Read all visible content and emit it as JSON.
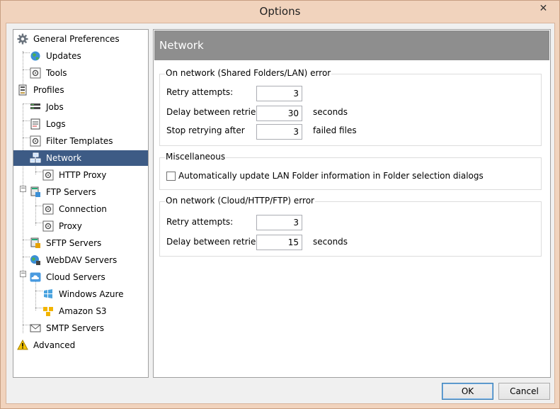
{
  "window": {
    "title": "Options",
    "close_glyph": "✕"
  },
  "tree": {
    "items": [
      {
        "label": "General Preferences",
        "icon": "gear-icon"
      },
      {
        "label": "Updates",
        "icon": "globe-icon"
      },
      {
        "label": "Tools",
        "icon": "tools-icon"
      },
      {
        "label": "Profiles",
        "icon": "profiles-icon"
      },
      {
        "label": "Jobs",
        "icon": "jobs-icon"
      },
      {
        "label": "Logs",
        "icon": "log-icon"
      },
      {
        "label": "Filter Templates",
        "icon": "filter-icon"
      },
      {
        "label": "Network",
        "icon": "network-icon"
      },
      {
        "label": "HTTP Proxy",
        "icon": "proxy-icon"
      },
      {
        "label": "FTP Servers",
        "icon": "ftp-icon"
      },
      {
        "label": "Connection",
        "icon": "connection-icon"
      },
      {
        "label": "Proxy",
        "icon": "proxy-icon"
      },
      {
        "label": "SFTP Servers",
        "icon": "sftp-icon"
      },
      {
        "label": "WebDAV Servers",
        "icon": "webdav-icon"
      },
      {
        "label": "Cloud Servers",
        "icon": "cloud-icon"
      },
      {
        "label": "Windows Azure",
        "icon": "azure-icon"
      },
      {
        "label": "Amazon S3",
        "icon": "s3-icon"
      },
      {
        "label": "SMTP Servers",
        "icon": "mail-icon"
      },
      {
        "label": "Advanced",
        "icon": "warning-icon"
      }
    ],
    "selected": "Network"
  },
  "panel": {
    "header": "Network",
    "lan_group": {
      "title": "On network (Shared Folders/LAN) error",
      "retry_label": "Retry attempts:",
      "retry_value": "3",
      "delay_label": "Delay between retries:",
      "delay_value": "30",
      "delay_unit": "seconds",
      "stop_label": "Stop retrying after",
      "stop_value": "3",
      "stop_unit": "failed files"
    },
    "misc_group": {
      "title": "Miscellaneous",
      "auto_update_label": "Automatically update LAN Folder information in Folder selection dialogs",
      "auto_update_checked": false
    },
    "cloud_group": {
      "title": "On network (Cloud/HTTP/FTP) error",
      "retry_label": "Retry attempts:",
      "retry_value": "3",
      "delay_label": "Delay between retries:",
      "delay_value": "15",
      "delay_unit": "seconds"
    }
  },
  "buttons": {
    "ok": "OK",
    "cancel": "Cancel"
  }
}
